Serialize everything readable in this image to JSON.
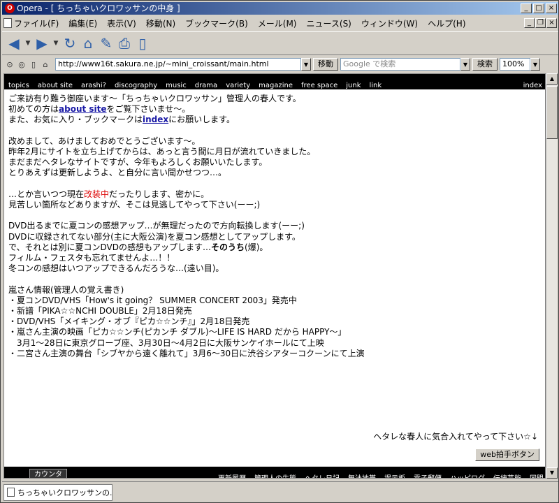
{
  "window": {
    "title": "Opera - [ ちっちゃいクロワッサンの中身 ]"
  },
  "menu": [
    "ファイル(F)",
    "編集(E)",
    "表示(V)",
    "移動(N)",
    "ブックマーク(B)",
    "メール(M)",
    "ニュース(S)",
    "ウィンドウ(W)",
    "ヘルプ(H)"
  ],
  "address": {
    "url": "http://www16t.sakura.ne.jp/~mini_croissant/main.html",
    "go_label": "移動"
  },
  "search": {
    "placeholder": "Google で検索",
    "button_label": "検索"
  },
  "zoom": "100%",
  "site_nav": {
    "links": [
      "topics",
      "about site",
      "arashi?",
      "discography",
      "music",
      "drama",
      "variety",
      "magazine",
      "free space",
      "junk",
      "link"
    ],
    "index": "index"
  },
  "content": {
    "intro1": "ご来訪有り難う御座います〜「ちっちゃいクロワッサン」管理人の春人です。",
    "intro2_pre": "初めての方は",
    "intro2_link": "about site",
    "intro2_post": "をご覧下さいませ〜。",
    "intro3_pre": "また、お気に入り・ブックマークは",
    "intro3_link": "index",
    "intro3_post": "にお願いします。",
    "p1": "改めまして、あけましておめでとうございます〜。",
    "p2": "昨年2月にサイトを立ち上げてからは、あっと言う間に月日が流れていきました。",
    "p3": "まだまだヘタレなサイトですが、今年もよろしくお願いいたします。",
    "p4": "とりあえずは更新しようよ、と自分に言い聞かせつつ…。",
    "r1_pre": "…とか言いつつ現在",
    "r1_red": "改装中",
    "r1_post": "だったりします、密かに。",
    "r2": "見苦しい箇所などありますが、そこは見逃してやって下さい(ーー;)",
    "d1": "DVD出るまでに夏コンの感想アップ…が無理だったので方向転換します(ーー;)",
    "d2": "DVDに収録されてない部分(主に大阪公演)を夏コン感想としてアップします。",
    "d3_pre": "で、それとは別に夏コンDVDの感想もアップします…",
    "d3_bold": "そのうち",
    "d3_post": "(爆)。",
    "d4": "フィルム・フェスタも忘れてませんよ…！！",
    "d5": "冬コンの感想はいつアップできるんだろうな…(遠い目)。",
    "info_title": "嵐さん情報(管理人の覚え書き)",
    "info": [
      "・夏コンDVD/VHS「How's it going？ SUMMER CONCERT 2003」発売中",
      "・新譜「PIKA☆☆NCHI DOUBLE」2月18日発売",
      "・DVD/VHS「メイキング・オブ『ピカ☆☆ンチ』」2月18日発売",
      "・嵐さん主演の映画「ピカ☆☆ンチ(ピカンチ ダブル)〜LIFE IS HARD だから HAPPY〜」",
      "　3月1〜28日に東京グローブ座、3月30日〜4月2日に大阪サンケイホールにて上映",
      "・二宮さん主演の舞台「シブヤから遠く離れて」3月6〜30日に渋谷シアターコクーンにて上演"
    ],
    "cheer": "ヘタレな春人に気合入れてやって下さい☆↓",
    "clap_button": "web拍手ボタン"
  },
  "footer": {
    "counter": "カウンタ",
    "links": [
      "更新履歴",
      "管理人の生態",
      "ヘタレ日記",
      "無法地帯",
      "掲示板",
      "電子郵便",
      "ハッピログ",
      "伝統芸能",
      "同盟"
    ]
  },
  "taskbar": {
    "tab_label": "ちっちゃいクロワッサンの..."
  }
}
